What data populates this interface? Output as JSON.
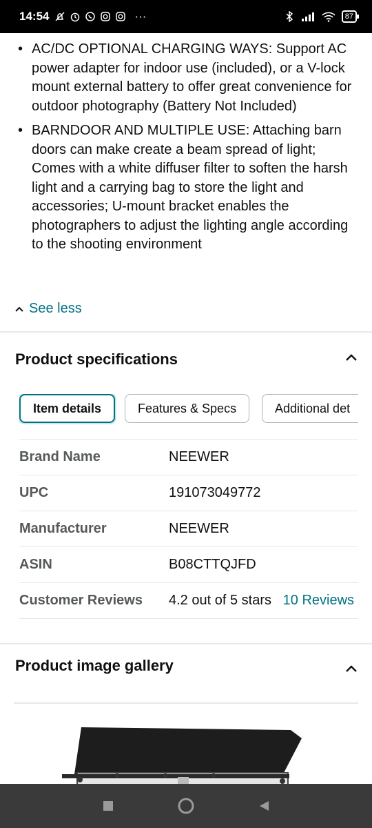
{
  "status_bar": {
    "time": "14:54",
    "left_icons": [
      "mute-icon",
      "alarm-icon",
      "whatsapp-icon",
      "instagram-icon",
      "instagram-icon",
      "more-dots-icon"
    ],
    "more": "···",
    "battery": "87"
  },
  "bullets": [
    "AC/DC OPTIONAL CHARGING WAYS: Support AC power adapter for indoor use (included), or a V-lock mount external battery to offer great convenience for outdoor photography (Battery Not Included)",
    "BARNDOOR AND MULTIPLE USE: Attaching barn doors can make create a beam spread of light; Comes with a white diffuser filter to soften the harsh light and a carrying bag to store the light and accessories; U-mount bracket enables the photographers to adjust the lighting angle according to the shooting environment"
  ],
  "see_less": "See less",
  "specs": {
    "title": "Product specifications",
    "tabs": [
      "Item details",
      "Features & Specs",
      "Additional det"
    ],
    "rows": [
      {
        "key": "Brand Name",
        "value": "NEEWER"
      },
      {
        "key": "UPC",
        "value": "191073049772"
      },
      {
        "key": "Manufacturer",
        "value": "NEEWER"
      },
      {
        "key": "ASIN",
        "value": "B08CTTQJFD"
      }
    ],
    "reviews": {
      "key": "Customer Reviews",
      "stars_text": "4.2 out of 5 stars",
      "link": "10 Reviews"
    }
  },
  "gallery": {
    "title": "Product image gallery"
  },
  "colors": {
    "link": "#007185",
    "text": "#0f1111",
    "muted": "#565959",
    "nav_bar": "#3a3a3a"
  }
}
